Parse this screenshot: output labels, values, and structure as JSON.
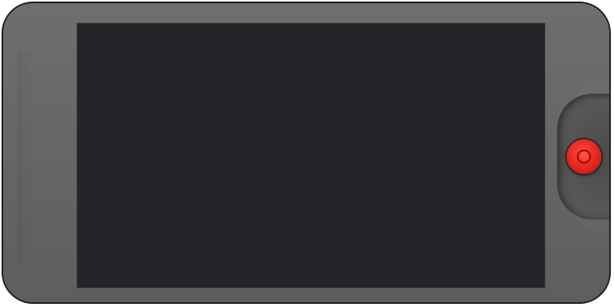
{
  "device": {
    "body_color": "#666666",
    "screen_color": "#232427",
    "record_button": {
      "icon": "record-icon",
      "color": "#e3261c"
    }
  }
}
